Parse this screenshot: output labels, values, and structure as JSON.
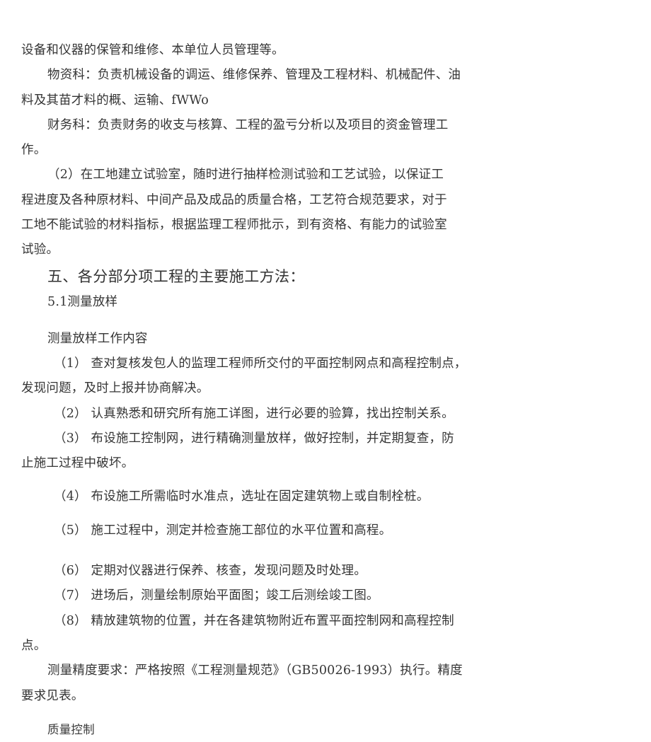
{
  "document": {
    "page_background": "#ffffff",
    "text_color": "#353535",
    "blocks": [
      {
        "id": "b1",
        "kind": "paragraph-continuation",
        "lines": [
          "设备和仪器的保管和维修、本单位人员管理等。"
        ]
      },
      {
        "id": "b2",
        "kind": "paragraph",
        "lines": [
          "物资科：负责机械设备的调运、维修保养、管理及工程材料、机械配件、油",
          "料及其苗才料的概、运输、fWWo"
        ]
      },
      {
        "id": "b3",
        "kind": "paragraph",
        "lines": [
          "财务科：负责财务的收支与核算、工程的盈亏分析以及项目的资金管理工",
          "作。"
        ]
      },
      {
        "id": "b4",
        "kind": "paragraph",
        "lines": [
          "（2）在工地建立试验室，随时进行抽样检测试验和工艺试验，以保证工",
          "程进度及各种原材料、中间产品及成品的质量合格，工艺符合规范要求，对于",
          "工地不能试验的材料指标，根据监理工程师批示，到有资格、有能力的试验室",
          "试验。"
        ]
      },
      {
        "id": "b5",
        "kind": "heading",
        "lines": [
          "五、各分部分项工程的主要施工方法："
        ]
      },
      {
        "id": "b6",
        "kind": "subheading",
        "lines": [
          "5.1测量放样"
        ]
      },
      {
        "id": "b7",
        "kind": "paragraph",
        "lines": [
          "测量放样工作内容"
        ]
      },
      {
        "id": "b8",
        "kind": "list-item",
        "lines": [
          "（1） 查对复核发包人的监理工程师所交付的平面控制网点和高程控制点，",
          "发现问题，及时上报并协商解决。"
        ]
      },
      {
        "id": "b9",
        "kind": "list-item",
        "lines": [
          "（2） 认真熟悉和研究所有施工详图，进行必要的验算，找出控制关系。"
        ]
      },
      {
        "id": "b10",
        "kind": "list-item",
        "lines": [
          "（3） 布设施工控制网，进行精确测量放样，做好控制，并定期复查，防",
          "止施工过程中破坏。"
        ]
      },
      {
        "id": "b11",
        "kind": "list-item",
        "lines": [
          "（4） 布设施工所需临时水准点，选址在固定建筑物上或自制栓桩。"
        ]
      },
      {
        "id": "b12",
        "kind": "list-item",
        "lines": [
          "（5） 施工过程中，测定并检查施工部位的水平位置和高程。"
        ]
      },
      {
        "id": "b13",
        "kind": "list-item",
        "lines": [
          "（6） 定期对仪器进行保养、核查，发现问题及时处理。"
        ]
      },
      {
        "id": "b14",
        "kind": "list-item",
        "lines": [
          "（7） 进场后，测量绘制原始平面图；竣工后测绘竣工图。"
        ]
      },
      {
        "id": "b15",
        "kind": "list-item",
        "lines": [
          "（8） 精放建筑物的位置，并在各建筑物附近布置平面控制网和高程控制",
          "点。"
        ]
      },
      {
        "id": "b16",
        "kind": "paragraph",
        "lines": [
          "测量精度要求：严格按照《工程测量规范》（GB50026-1993）执行。精度",
          "要求见表。"
        ]
      },
      {
        "id": "b17",
        "kind": "paragraph-hei",
        "lines": [
          "质量控制"
        ]
      }
    ]
  }
}
